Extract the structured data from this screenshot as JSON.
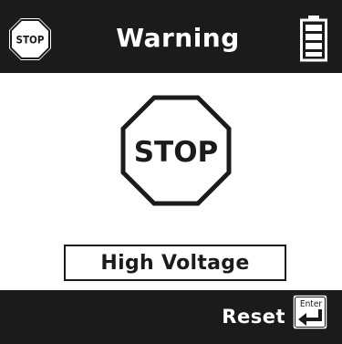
{
  "header": {
    "title": "Warning",
    "stop_icon_text": "STOP",
    "battery_icon": "battery-full-icon"
  },
  "main": {
    "stop_sign_text": "STOP",
    "message": "High Voltage"
  },
  "footer": {
    "reset_label": "Reset",
    "enter_key_label": "Enter"
  },
  "colors": {
    "bar_background": "#1b1b1b",
    "screen_background": "#ffffff",
    "foreground_on_bar": "#ffffff",
    "foreground_on_screen": "#1b1b1b"
  }
}
